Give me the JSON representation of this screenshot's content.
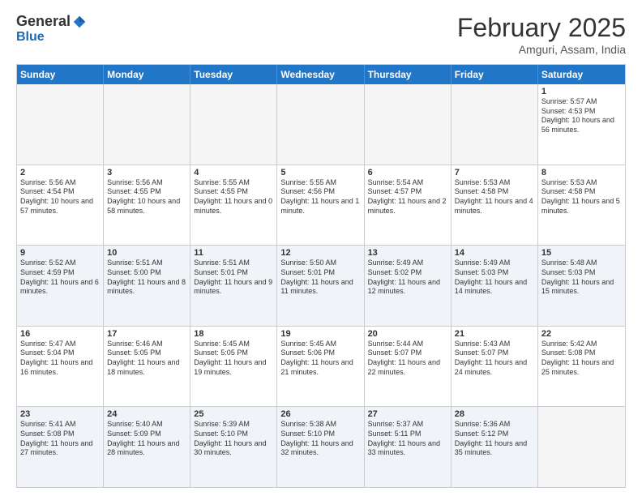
{
  "header": {
    "logo_general": "General",
    "logo_blue": "Blue",
    "month_year": "February 2025",
    "location": "Amguri, Assam, India"
  },
  "day_headers": [
    "Sunday",
    "Monday",
    "Tuesday",
    "Wednesday",
    "Thursday",
    "Friday",
    "Saturday"
  ],
  "weeks": [
    {
      "alt": false,
      "days": [
        {
          "num": "",
          "info": ""
        },
        {
          "num": "",
          "info": ""
        },
        {
          "num": "",
          "info": ""
        },
        {
          "num": "",
          "info": ""
        },
        {
          "num": "",
          "info": ""
        },
        {
          "num": "",
          "info": ""
        },
        {
          "num": "1",
          "info": "Sunrise: 5:57 AM\nSunset: 4:53 PM\nDaylight: 10 hours and 56 minutes."
        }
      ]
    },
    {
      "alt": false,
      "days": [
        {
          "num": "2",
          "info": "Sunrise: 5:56 AM\nSunset: 4:54 PM\nDaylight: 10 hours and 57 minutes."
        },
        {
          "num": "3",
          "info": "Sunrise: 5:56 AM\nSunset: 4:55 PM\nDaylight: 10 hours and 58 minutes."
        },
        {
          "num": "4",
          "info": "Sunrise: 5:55 AM\nSunset: 4:55 PM\nDaylight: 11 hours and 0 minutes."
        },
        {
          "num": "5",
          "info": "Sunrise: 5:55 AM\nSunset: 4:56 PM\nDaylight: 11 hours and 1 minute."
        },
        {
          "num": "6",
          "info": "Sunrise: 5:54 AM\nSunset: 4:57 PM\nDaylight: 11 hours and 2 minutes."
        },
        {
          "num": "7",
          "info": "Sunrise: 5:53 AM\nSunset: 4:58 PM\nDaylight: 11 hours and 4 minutes."
        },
        {
          "num": "8",
          "info": "Sunrise: 5:53 AM\nSunset: 4:58 PM\nDaylight: 11 hours and 5 minutes."
        }
      ]
    },
    {
      "alt": true,
      "days": [
        {
          "num": "9",
          "info": "Sunrise: 5:52 AM\nSunset: 4:59 PM\nDaylight: 11 hours and 6 minutes."
        },
        {
          "num": "10",
          "info": "Sunrise: 5:51 AM\nSunset: 5:00 PM\nDaylight: 11 hours and 8 minutes."
        },
        {
          "num": "11",
          "info": "Sunrise: 5:51 AM\nSunset: 5:01 PM\nDaylight: 11 hours and 9 minutes."
        },
        {
          "num": "12",
          "info": "Sunrise: 5:50 AM\nSunset: 5:01 PM\nDaylight: 11 hours and 11 minutes."
        },
        {
          "num": "13",
          "info": "Sunrise: 5:49 AM\nSunset: 5:02 PM\nDaylight: 11 hours and 12 minutes."
        },
        {
          "num": "14",
          "info": "Sunrise: 5:49 AM\nSunset: 5:03 PM\nDaylight: 11 hours and 14 minutes."
        },
        {
          "num": "15",
          "info": "Sunrise: 5:48 AM\nSunset: 5:03 PM\nDaylight: 11 hours and 15 minutes."
        }
      ]
    },
    {
      "alt": false,
      "days": [
        {
          "num": "16",
          "info": "Sunrise: 5:47 AM\nSunset: 5:04 PM\nDaylight: 11 hours and 16 minutes."
        },
        {
          "num": "17",
          "info": "Sunrise: 5:46 AM\nSunset: 5:05 PM\nDaylight: 11 hours and 18 minutes."
        },
        {
          "num": "18",
          "info": "Sunrise: 5:45 AM\nSunset: 5:05 PM\nDaylight: 11 hours and 19 minutes."
        },
        {
          "num": "19",
          "info": "Sunrise: 5:45 AM\nSunset: 5:06 PM\nDaylight: 11 hours and 21 minutes."
        },
        {
          "num": "20",
          "info": "Sunrise: 5:44 AM\nSunset: 5:07 PM\nDaylight: 11 hours and 22 minutes."
        },
        {
          "num": "21",
          "info": "Sunrise: 5:43 AM\nSunset: 5:07 PM\nDaylight: 11 hours and 24 minutes."
        },
        {
          "num": "22",
          "info": "Sunrise: 5:42 AM\nSunset: 5:08 PM\nDaylight: 11 hours and 25 minutes."
        }
      ]
    },
    {
      "alt": true,
      "days": [
        {
          "num": "23",
          "info": "Sunrise: 5:41 AM\nSunset: 5:08 PM\nDaylight: 11 hours and 27 minutes."
        },
        {
          "num": "24",
          "info": "Sunrise: 5:40 AM\nSunset: 5:09 PM\nDaylight: 11 hours and 28 minutes."
        },
        {
          "num": "25",
          "info": "Sunrise: 5:39 AM\nSunset: 5:10 PM\nDaylight: 11 hours and 30 minutes."
        },
        {
          "num": "26",
          "info": "Sunrise: 5:38 AM\nSunset: 5:10 PM\nDaylight: 11 hours and 32 minutes."
        },
        {
          "num": "27",
          "info": "Sunrise: 5:37 AM\nSunset: 5:11 PM\nDaylight: 11 hours and 33 minutes."
        },
        {
          "num": "28",
          "info": "Sunrise: 5:36 AM\nSunset: 5:12 PM\nDaylight: 11 hours and 35 minutes."
        },
        {
          "num": "",
          "info": ""
        }
      ]
    }
  ]
}
